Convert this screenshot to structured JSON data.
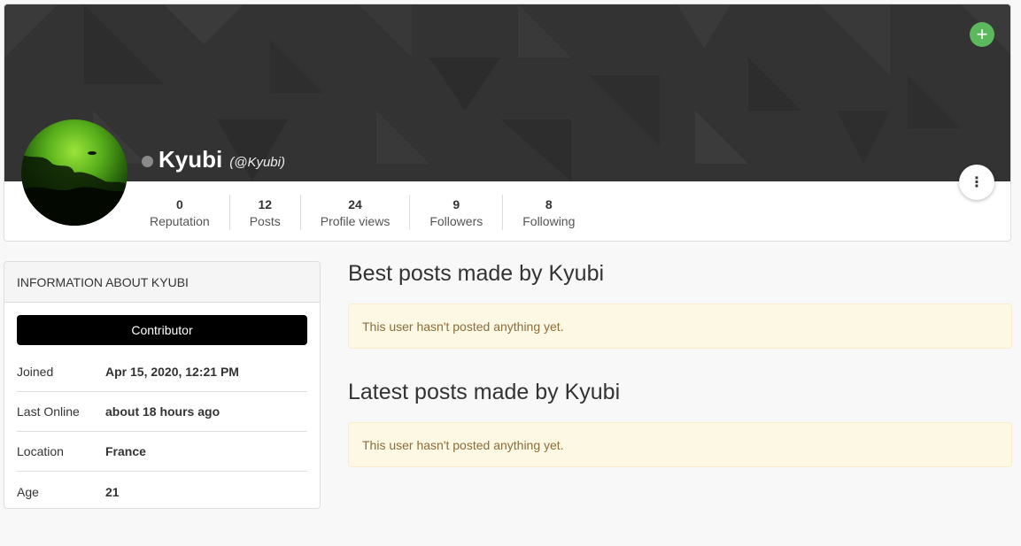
{
  "profile": {
    "display_name": "Kyubi",
    "slug": "(@Kyubi)",
    "status": "offline",
    "status_color": "#8a8a8a",
    "add_cover_icon": "+",
    "menu_icon": "⋮",
    "stats": [
      {
        "value": "0",
        "label": "Reputation"
      },
      {
        "value": "12",
        "label": "Posts"
      },
      {
        "value": "24",
        "label": "Profile views"
      },
      {
        "value": "9",
        "label": "Followers"
      },
      {
        "value": "8",
        "label": "Following"
      }
    ]
  },
  "info": {
    "header": "Information about Kyubi",
    "group": "Contributor",
    "rows": [
      {
        "label": "Joined",
        "value": "Apr 15, 2020, 12:21 PM"
      },
      {
        "label": "Last Online",
        "value": "about 18 hours ago"
      },
      {
        "label": "Location",
        "value": "France"
      },
      {
        "label": "Age",
        "value": "21"
      }
    ]
  },
  "posts": {
    "best_title": "Best posts made by Kyubi",
    "best_empty": "This user hasn't posted anything yet.",
    "latest_title": "Latest posts made by Kyubi",
    "latest_empty": "This user hasn't posted anything yet."
  },
  "colors": {
    "accent_green": "#5cb85c",
    "cover": "#333333",
    "alert_bg": "#fcf8e3",
    "alert_text": "#8a6d3b"
  }
}
